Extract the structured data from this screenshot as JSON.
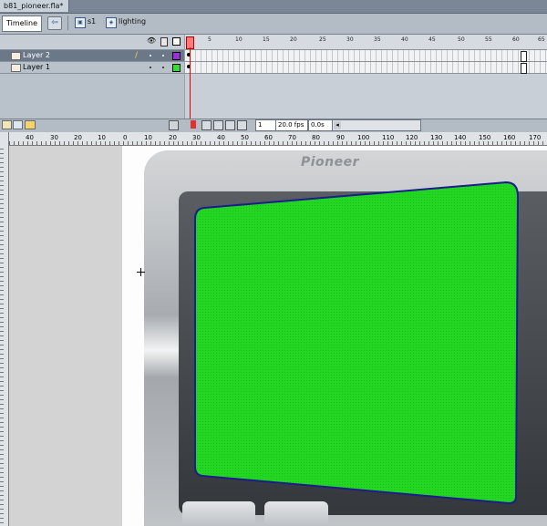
{
  "document": {
    "tab_title": "b81_pioneer.fla*"
  },
  "edit_bar": {
    "timeline_label": "Timeline",
    "breadcrumbs": [
      {
        "label": "s1",
        "icon": "scene-icon"
      },
      {
        "label": "lighting",
        "icon": "graphic-symbol-icon"
      }
    ]
  },
  "timeline": {
    "frame_numbers": [
      "1",
      "5",
      "10",
      "15",
      "20",
      "25",
      "30",
      "35",
      "40",
      "45",
      "50",
      "55",
      "60",
      "65"
    ],
    "layers": [
      {
        "name": "Layer 2",
        "selected": true,
        "color": "#9b30d9"
      },
      {
        "name": "Layer 1",
        "selected": false,
        "color": "#33dd33"
      }
    ],
    "status": {
      "current_frame": "1",
      "frame_rate": "20.0 fps",
      "elapsed": "0.0s"
    }
  },
  "ruler": {
    "h_labels": [
      "40",
      "30",
      "20",
      "10",
      "0",
      "10",
      "20",
      "30",
      "40",
      "50",
      "60",
      "70",
      "80",
      "90",
      "100",
      "110",
      "120",
      "130",
      "140",
      "150",
      "160",
      "170"
    ]
  },
  "stage": {
    "brand_text": "Pioneer",
    "screen_color": "#22d622",
    "screen_outline": "#1c1c8c"
  },
  "colors": {
    "playhead": "#e00000",
    "selection_bar": "#6b7888"
  }
}
